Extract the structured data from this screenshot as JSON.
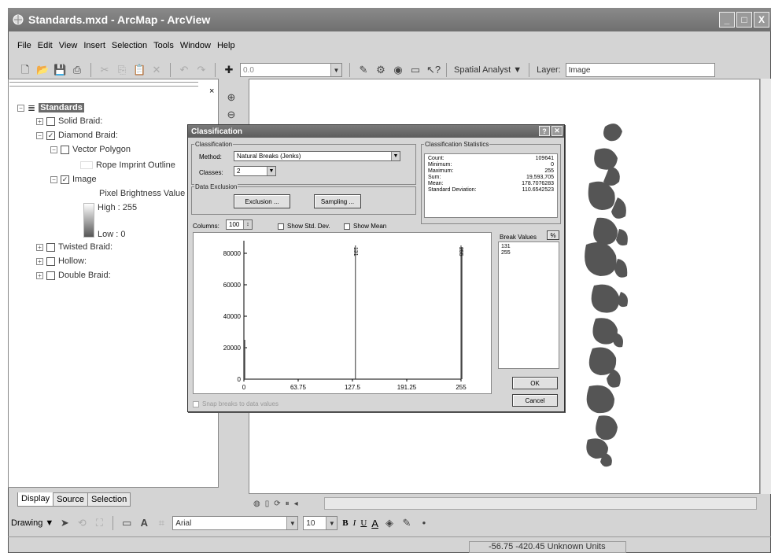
{
  "window": {
    "title": "Standards.mxd - ArcMap - ArcView",
    "controls": [
      "_",
      "□",
      "X"
    ]
  },
  "menu": [
    "File",
    "Edit",
    "View",
    "Insert",
    "Selection",
    "Tools",
    "Window",
    "Help"
  ],
  "toolbar": {
    "scale_value": "0.0",
    "spatial_analyst_label": "Spatial Analyst ▼",
    "layer_label": "Layer:",
    "layer_value": "Image"
  },
  "toc": {
    "root": "Standards",
    "items": [
      {
        "label": "Solid Braid:",
        "checked": false
      },
      {
        "label": "Diamond Braid:",
        "checked": true
      },
      {
        "label": "Vector Polygon",
        "checked": false
      },
      {
        "label": "Rope Imprint Outline"
      },
      {
        "label": "Image",
        "checked": true
      },
      {
        "label": "Pixel Brightness Value"
      },
      {
        "label": "High : 255"
      },
      {
        "label": "Low : 0"
      },
      {
        "label": "Twisted Braid:",
        "checked": false
      },
      {
        "label": "Hollow:",
        "checked": false
      },
      {
        "label": "Double Braid:",
        "checked": false
      }
    ],
    "tabs": [
      "Display",
      "Source",
      "Selection"
    ]
  },
  "drawing_toolbar": {
    "drawing_label": "Drawing ▼",
    "font_name": "Arial",
    "font_size": "10",
    "bold": "B",
    "italic": "I",
    "underline": "U",
    "font_color": "A"
  },
  "status": {
    "coords": "-56.75  -420.45 Unknown Units"
  },
  "dialog": {
    "title": "Classification",
    "classification_group": "Classification",
    "method_label": "Method:",
    "method_value": "Natural Breaks (Jenks)",
    "classes_label": "Classes:",
    "classes_value": "2",
    "data_exclusion_group": "Data Exclusion",
    "exclusion_button": "Exclusion ...",
    "sampling_button": "Sampling ...",
    "stats_group": "Classification Statistics",
    "stats": [
      {
        "label": "Count:",
        "value": "109641"
      },
      {
        "label": "Minimum:",
        "value": "0"
      },
      {
        "label": "Maximum:",
        "value": "255"
      },
      {
        "label": "Sum:",
        "value": "19,593,705"
      },
      {
        "label": "Mean:",
        "value": "178.7076283"
      },
      {
        "label": "Standard Deviation:",
        "value": "110.6542523"
      }
    ],
    "columns_label": "Columns:",
    "columns_value": "100",
    "show_std_dev": "Show Std. Dev.",
    "show_mean": "Show Mean",
    "break_values_label": "Break Values",
    "percent_button": "%",
    "break_values": [
      "131",
      "255"
    ],
    "ok_button": "OK",
    "cancel_button": "Cancel",
    "snap_label": "Snap breaks to data values"
  },
  "chart_data": {
    "type": "bar",
    "x_ticks": [
      "0",
      "63.75",
      "127.5",
      "191.25",
      "255"
    ],
    "y_ticks": [
      "0",
      "20000",
      "40000",
      "60000",
      "80000"
    ],
    "xlim": [
      0,
      255
    ],
    "ylim": [
      0,
      85000
    ],
    "bars": [
      {
        "x": 0,
        "value": 25000
      },
      {
        "x": 255,
        "value": 84000
      }
    ],
    "break_lines": [
      {
        "x": 131,
        "label": "131"
      },
      {
        "x": 255,
        "label": "255"
      }
    ]
  }
}
